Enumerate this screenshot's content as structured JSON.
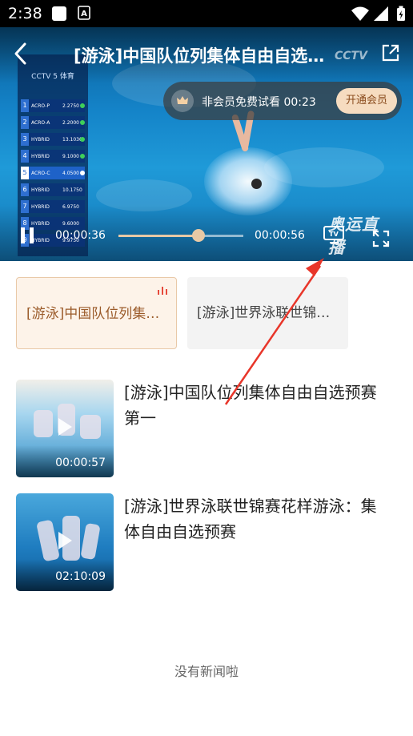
{
  "status_bar": {
    "time": "2:38",
    "icons": [
      "square-icon",
      "a-keyboard-icon",
      "wifi-icon",
      "signal-icon",
      "battery-charging-icon"
    ]
  },
  "player": {
    "title": "[游泳]中国队位列集体自由自选预赛第一",
    "watermark": "CCTV",
    "channel_logo": "奥运直播",
    "trial": {
      "text": "非会员免费试看 00:23",
      "button_label": "开通会员"
    },
    "current_time": "00:00:36",
    "total_time": "00:00:56",
    "progress_fraction": 0.64,
    "scoreboard": {
      "header": "CCTV 5 体育",
      "rows": [
        {
          "rank": "1",
          "name": "ACRO-P",
          "score": "2.2750"
        },
        {
          "rank": "2",
          "name": "ACRO-A",
          "score": "2.2000"
        },
        {
          "rank": "3",
          "name": "HYBRID",
          "score": "13.1030"
        },
        {
          "rank": "4",
          "name": "HYBRID",
          "score": "9.1000"
        },
        {
          "rank": "5",
          "name": "ACRO-C",
          "score": "4.0500"
        },
        {
          "rank": "6",
          "name": "HYBRID",
          "score": "10.1750"
        },
        {
          "rank": "7",
          "name": "HYBRID",
          "score": "6.9750"
        },
        {
          "rank": "8",
          "name": "HYBRID",
          "score": "9.6000"
        },
        {
          "rank": "9",
          "name": "HYBRID",
          "score": "9.9750"
        }
      ]
    }
  },
  "episodes": [
    {
      "label": "[游泳]中国队位列集体自由自选预赛第一",
      "active": true
    },
    {
      "label": "[游泳]世界泳联世锦赛花样游泳：集体自由自选预赛",
      "active": false
    }
  ],
  "videos": [
    {
      "title": "[游泳]中国队位列集体自由自选预赛第一",
      "duration": "00:00:57"
    },
    {
      "title": "[游泳]世界泳联世锦赛花样游泳：集体自由自选预赛",
      "duration": "02:10:09"
    }
  ],
  "footer": {
    "no_more_text": "没有新闻啦"
  },
  "colors": {
    "accent": "#e8c9a5",
    "active_chip_text": "#9b5b2a",
    "annotation_arrow": "#e8362a"
  }
}
